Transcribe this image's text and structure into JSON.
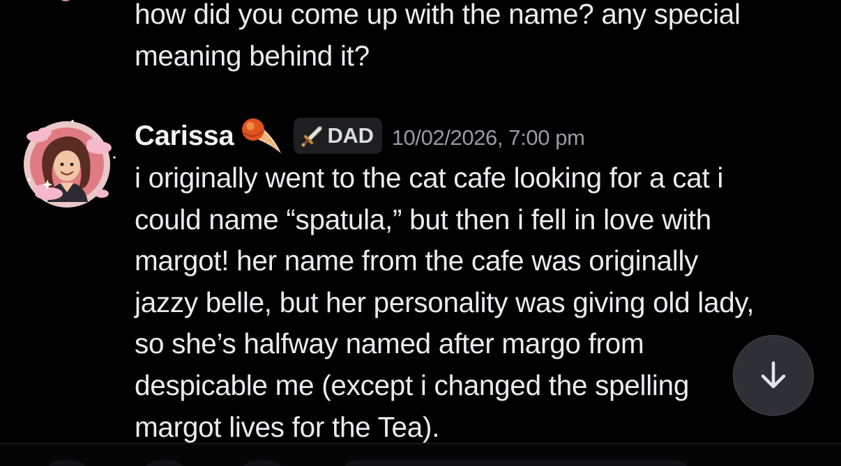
{
  "previous_message": {
    "text": "how did you come up with the name? any special\nmeaning behind it?"
  },
  "message": {
    "author": "Carissa",
    "role_tag": "DAD",
    "timestamp": "10/02/2026, 7:00 pm",
    "text": "i originally went to the cat cafe looking for a cat i\ncould name “spatula,” but then i fell in love with\nmargot! her name from the cafe was originally\njazzy belle, but her personality was giving old lady,\nso she’s halfway named after margo from\ndespicable me (except i changed the spelling\nmargot lives for the Tea)."
  },
  "icons": {
    "avatar": "avatar-illustration-with-clouds",
    "name_decoration": "comet-icon",
    "role_icon": "sword-icon",
    "scroll_button": "arrow-down-icon"
  },
  "colors": {
    "background": "#000000",
    "message_text": "#ececef",
    "username": "#f2f3f5",
    "timestamp": "#9a9ba2",
    "role_tag_bg": "#1f1f22",
    "scroll_button_bg": "#2f3035"
  }
}
